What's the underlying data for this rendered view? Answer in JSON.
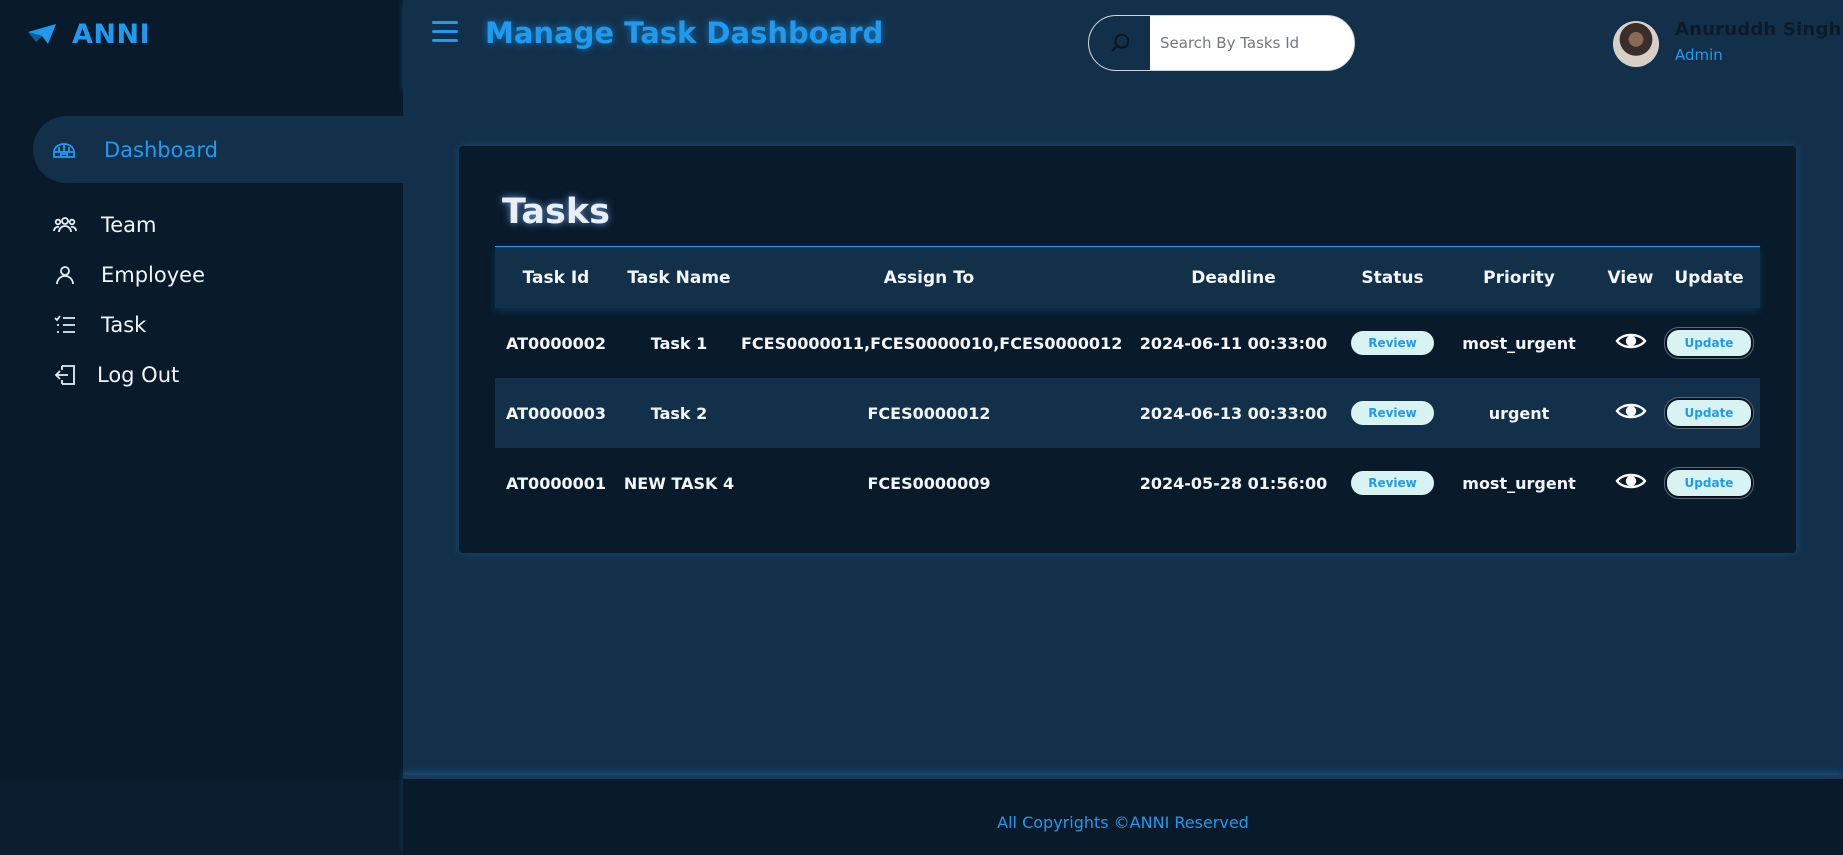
{
  "brand": {
    "name": "ANNI",
    "icon": "paper-plane-icon"
  },
  "sidebar": {
    "items": [
      {
        "label": "Dashboard",
        "icon": "igloo-icon",
        "active": true
      },
      {
        "label": "Team",
        "icon": "team-icon"
      },
      {
        "label": "Employee",
        "icon": "user-icon"
      },
      {
        "label": "Task",
        "icon": "task-list-icon"
      },
      {
        "label": "Log Out",
        "icon": "logout-icon"
      }
    ]
  },
  "header": {
    "title": "Manage Task Dashboard",
    "search_placeholder": "Search By Tasks Id",
    "user": {
      "name": "Anuruddh Singh",
      "role": "Admin"
    }
  },
  "tasks": {
    "title": "Tasks",
    "columns": [
      "Task Id",
      "Task Name",
      "Assign To",
      "Deadline",
      "Status",
      "Priority",
      "View",
      "Update"
    ],
    "rows": [
      {
        "id": "AT0000002",
        "name": "Task 1",
        "assign_to": "FCES0000011,FCES0000010,FCES0000012",
        "deadline": "2024-06-11 00:33:00",
        "status": "Review",
        "priority": "most_urgent",
        "update": "Update"
      },
      {
        "id": "AT0000003",
        "name": "Task 2",
        "assign_to": "FCES0000012",
        "deadline": "2024-06-13 00:33:00",
        "status": "Review",
        "priority": "urgent",
        "update": "Update"
      },
      {
        "id": "AT0000001",
        "name": "NEW TASK 4",
        "assign_to": "FCES0000009",
        "deadline": "2024-05-28 01:56:00",
        "status": "Review",
        "priority": "most_urgent",
        "update": "Update"
      }
    ]
  },
  "footer": {
    "text": "All Copyrights ©ANNI Reserved"
  },
  "colors": {
    "accent": "#1e9bf0",
    "sidebar_bg": "#091a2a",
    "main_bg": "#13304a",
    "badge_bg": "#d9f3f3"
  }
}
